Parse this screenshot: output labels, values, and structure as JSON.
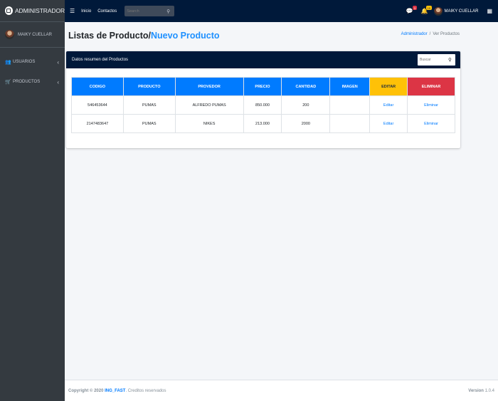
{
  "brand": {
    "title": "ADMINISTRADOR",
    "icon": "logo-icon"
  },
  "sidebar": {
    "user_name": "MAIKY CUELLAR",
    "items": [
      {
        "label": "USUARIOS",
        "icon": "users-icon"
      },
      {
        "label": "PRODUCTOS",
        "icon": "cart-icon"
      }
    ]
  },
  "topbar": {
    "links": [
      "Inicio",
      "Contactos"
    ],
    "search_placeholder": "Search",
    "notif_badge": "3",
    "msg_badge": "15",
    "user_name": "MAIKY CUELLAR"
  },
  "header": {
    "title": "Listas de Producto/",
    "title_link": "Nuevo Producto",
    "breadcrumb": [
      "Administrador",
      "Ver Productos"
    ]
  },
  "card": {
    "title": "Datos resumen del Productos",
    "search_placeholder": "Buscar",
    "columns": [
      "CODIGO",
      "PRODUCTO",
      "PROVEDOR",
      "PRECIO",
      "CANTIDAD",
      "IMAGEN",
      "EDITAR",
      "ELIMINAR"
    ],
    "rows": [
      [
        "546453644",
        "PUMAS",
        "ALFREDO PUMAS",
        "850.000",
        "200",
        "",
        "Editar",
        "Eliminar"
      ],
      [
        "2147483647",
        "PUMAS",
        "NIKES",
        "213.000",
        "2000",
        "",
        "Editar",
        "Eliminar"
      ]
    ]
  },
  "footer": {
    "copyright": "Copyright © 2020",
    "brand": "ING_FAST",
    "rights": "Creditos reservados",
    "version_label": "Version",
    "version": "1.0.4"
  },
  "colors": {
    "navy": "#00193a",
    "primary": "#007bff",
    "warning": "#ffc107",
    "danger": "#dc3545",
    "sidebar": "#343a40"
  }
}
